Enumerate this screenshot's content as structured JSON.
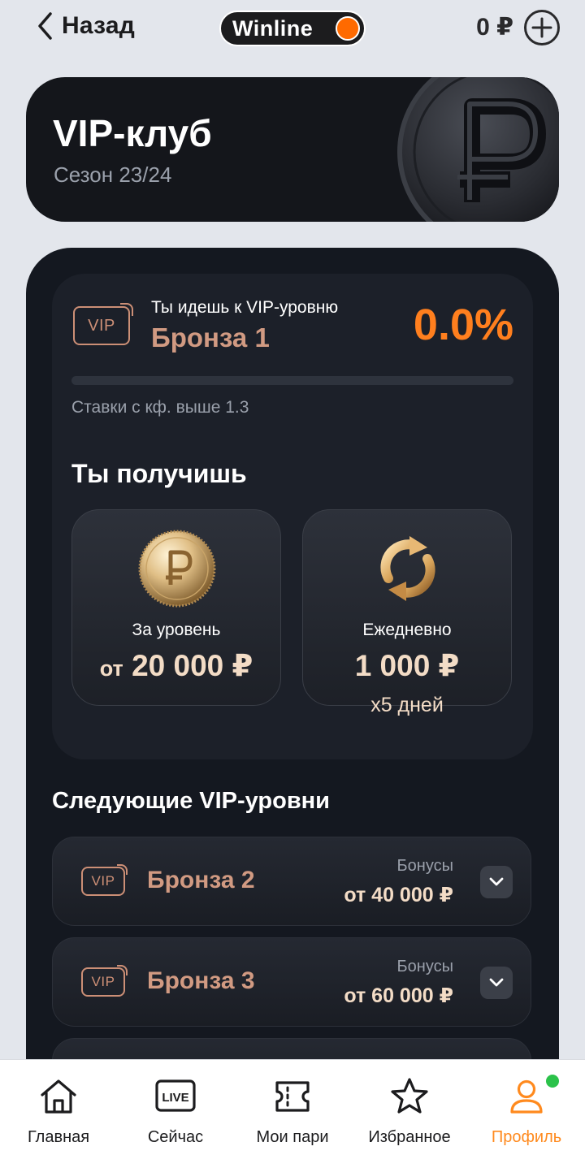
{
  "header": {
    "back_label": "Назад",
    "logo_text": "Winline",
    "balance": "0 ₽"
  },
  "hero": {
    "title": "VIP-клуб",
    "season": "Сезон 23/24"
  },
  "progress": {
    "going_text": "Ты идешь к VIP-уровню",
    "badge": "VIP",
    "level": "Бронза 1",
    "percent_text": "0.0%",
    "percent_value": 0,
    "condition": "Ставки с кф. выше 1.3"
  },
  "rewards": {
    "title": "Ты получишь",
    "items": [
      {
        "label": "За уровень",
        "prefix": "от",
        "amount": "20 000 ₽",
        "extra": "",
        "icon": "gold-ruble-coin-icon"
      },
      {
        "label": "Ежедневно",
        "prefix": "",
        "amount": "1 000 ₽",
        "extra": "x5 дней",
        "icon": "gold-refresh-arrows-icon"
      }
    ]
  },
  "next_levels": {
    "title": "Следующие VIP-уровни",
    "items": [
      {
        "badge": "VIP",
        "name": "Бронза 2",
        "bonus_label": "Бонусы",
        "bonus_value": "от 40 000 ₽"
      },
      {
        "badge": "VIP",
        "name": "Бронза 3",
        "bonus_label": "Бонусы",
        "bonus_value": "от 60 000 ₽"
      }
    ]
  },
  "nav": {
    "items": [
      {
        "label": "Главная",
        "icon": "home-icon"
      },
      {
        "label": "Сейчас",
        "icon": "live-icon",
        "icon_text": "LIVE"
      },
      {
        "label": "Мои пари",
        "icon": "ticket-icon"
      },
      {
        "label": "Избранное",
        "icon": "star-icon"
      },
      {
        "label": "Профиль",
        "icon": "profile-icon",
        "active": true
      }
    ]
  },
  "colors": {
    "accent": "#ff7f1e",
    "bronze": "#d19a82",
    "panel": "#141820",
    "online_dot": "#2bc24a"
  }
}
